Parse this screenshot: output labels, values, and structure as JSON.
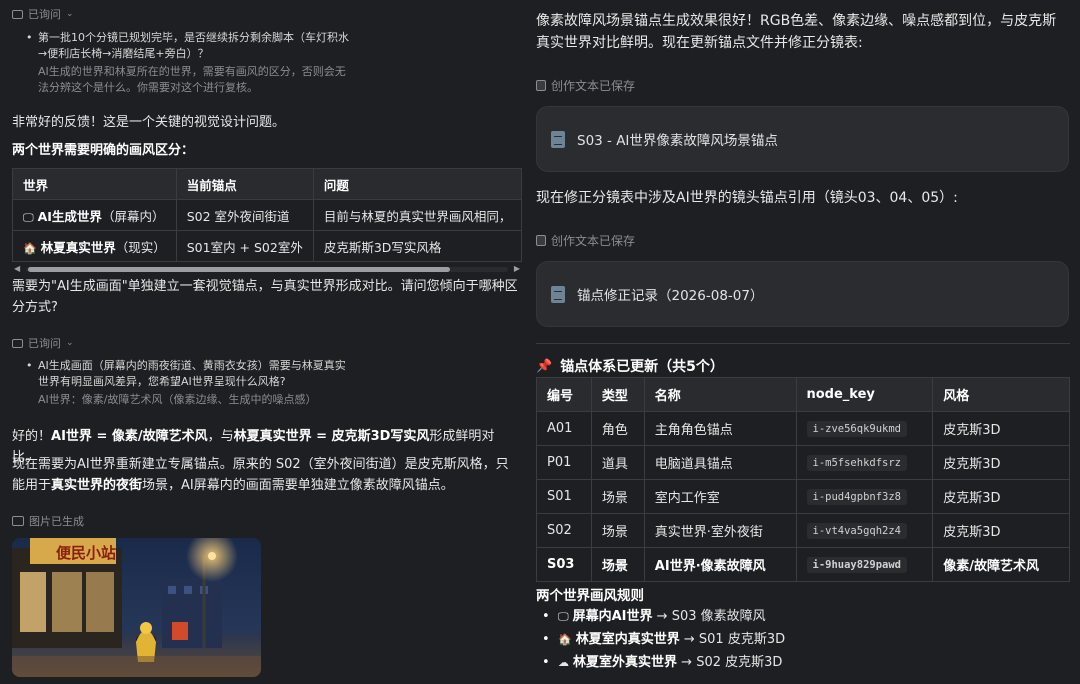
{
  "left": {
    "flag_referenced_1": "已询问",
    "ref1": {
      "bullet": "第一批10个分镜已规划完毕，是否继续拆分剩余脚本（车灯积水→便利店长椅→消磨结尾+旁白）？",
      "sub": "AI生成的世界和林夏所在的世界，需要有画风的区分，否则会无法分辨这个是什么。你需要对这个进行复核。"
    },
    "reply1": "非常好的反馈！这是一个关键的视觉设计问题。",
    "heading1": "两个世界需要明确的画风区分：",
    "table": {
      "headers": [
        "世界",
        "当前锚点",
        "问题"
      ],
      "rows": [
        {
          "icon": "🖵",
          "name": "AI生成世界",
          "suffix": "（屏幕内）",
          "anchor": "S02 室外夜间街道",
          "issue": "目前与林夏的真实世界画风相同，"
        },
        {
          "icon": "🏠",
          "name": "林夏真实世界",
          "suffix": "（现实）",
          "anchor": "S01室内 + S02室外",
          "issue": "皮克斯斯3D写实风格"
        }
      ]
    },
    "question": "需要为\"AI生成画面\"单独建立一套视觉锚点，与真实世界形成对比。请问您倾向于哪种区分方式?",
    "flag_referenced_2": "已询问",
    "ref2": {
      "bullet": "AI生成画面（屏幕内的雨夜街道、黄雨衣女孩）需要与林夏真实世界有明显画风差异，您希望AI世界呈现什么风格?",
      "sub": "AI世界：像素/故障艺术风（像素边缘、生成中的噪点感）"
    },
    "reply2": {
      "p1": "好的！",
      "b1": "AI世界 = 像素/故障艺术风",
      "p2": "，与",
      "b2": "林夏真实世界 = 皮克斯3D写实风",
      "p3": "形成鲜明对比。"
    },
    "reply3": {
      "p1": "现在需要为AI世界重新建立专属锚点。原来的 S02（室外夜间街道）是皮克斯风格，只能用于",
      "b1": "真实世界的夜街",
      "p2": "场景，AI屏幕内的画面需要单独建立像素故障风锚点。"
    },
    "image_flag": "图片已生成",
    "image_sign": "便民小站"
  },
  "right": {
    "intro": "像素故障风场景锚点生成效果很好！RGB色差、像素边缘、噪点感都到位，与皮克斯真实世界对比鲜明。现在更新锚点文件并修正分镜表:",
    "saved1": "创作文本已保存",
    "card1": "S03 - AI世界像素故障风场景锚点",
    "middle": "现在修正分镜表中涉及AI世界的镜头锚点引用（镜头03、04、05）:",
    "saved2": "创作文本已保存",
    "card2": "锚点修正记录（2026-08-07）",
    "heading": "锚点体系已更新（共5个）",
    "table": {
      "headers": [
        "编号",
        "类型",
        "名称",
        "node_key",
        "风格"
      ],
      "rows": [
        {
          "id": "A01",
          "type": "角色",
          "name": "主角角色锚点",
          "key": "i-zve56qk9ukmd",
          "style": "皮克斯3D",
          "bold": false
        },
        {
          "id": "P01",
          "type": "道具",
          "name": "电脑道具锚点",
          "key": "i-m5fsehkdfsrz",
          "style": "皮克斯3D",
          "bold": false
        },
        {
          "id": "S01",
          "type": "场景",
          "name": "室内工作室",
          "key": "i-pud4gpbnf3z8",
          "style": "皮克斯3D",
          "bold": false
        },
        {
          "id": "S02",
          "type": "场景",
          "name": "真实世界·室外夜街",
          "key": "i-vt4va5gqh2z4",
          "style": "皮克斯3D",
          "bold": false
        },
        {
          "id": "S03",
          "type": "场景",
          "name": "AI世界·像素故障风",
          "key": "i-9huay829pawd",
          "style": "像素/故障艺术风",
          "bold": true
        }
      ]
    },
    "rules_heading": "两个世界画风规则",
    "rules": [
      {
        "icon": "🖵",
        "label": "屏幕内AI世界",
        "arrow": "→",
        "value": "S03 像素故障风"
      },
      {
        "icon": "🏠",
        "label": "林夏室内真实世界",
        "arrow": "→",
        "value": "S01 皮克斯3D"
      },
      {
        "icon": "☁",
        "label": "林夏室外真实世界",
        "arrow": "→",
        "value": "S02 皮克斯3D"
      }
    ]
  }
}
